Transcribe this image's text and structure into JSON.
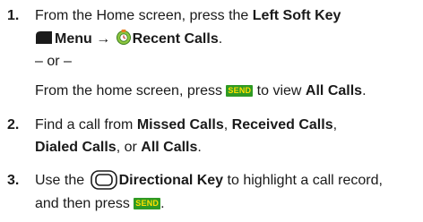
{
  "steps": [
    {
      "number": "1.",
      "line1": {
        "pre": "From the Home screen, press the ",
        "bold": "Left Soft Key"
      },
      "line2": {
        "menu": "Menu",
        "arrow": " → ",
        "recent": "Recent Calls",
        "end": "."
      },
      "or": "– or –",
      "line4": {
        "pre": "From the home screen, press ",
        "send": "SEND",
        "mid": " to view ",
        "bold": "All Calls",
        "end": "."
      }
    },
    {
      "number": "2.",
      "line1": {
        "pre": "Find a call from ",
        "bold1": "Missed Calls",
        "sep1": ", ",
        "bold2": "Received Calls",
        "sep2": ","
      },
      "line2": {
        "bold1": "Dialed Calls",
        "mid": ", or ",
        "bold2": "All Calls",
        "end": "."
      }
    },
    {
      "number": "3.",
      "line1": {
        "pre": "Use the ",
        "bold": "Directional Key",
        "post": " to highlight a call record,"
      },
      "line2": {
        "pre": "and then press ",
        "send": "SEND",
        "end": "."
      }
    }
  ],
  "icons": {
    "menu_icon": "left-soft-key-icon",
    "recent_icon": "recent-calls-icon",
    "nav_icon": "directional-key-icon"
  },
  "colors": {
    "send_bg": "#2f9a24",
    "send_text": "#ffe000",
    "text": "#1a1a1a"
  }
}
